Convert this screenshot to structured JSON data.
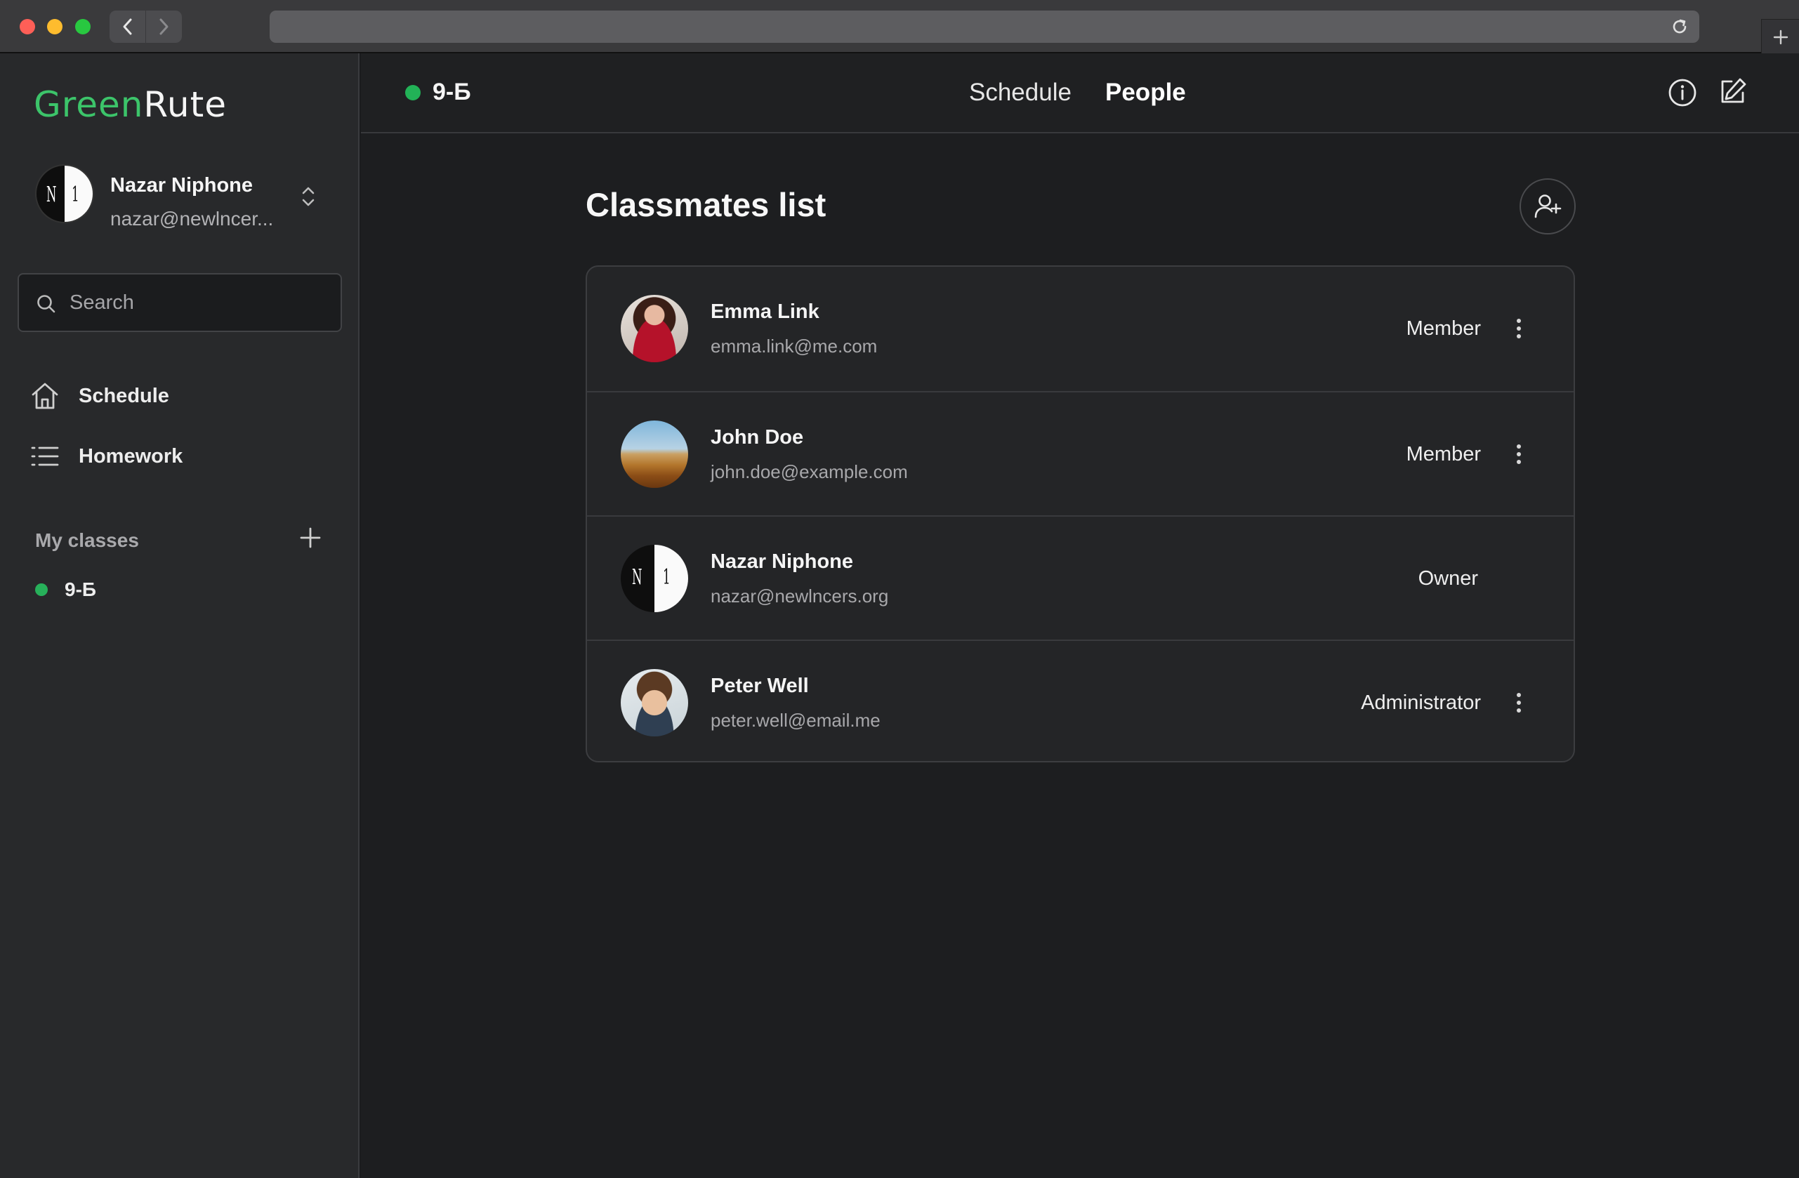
{
  "app": {
    "brand_left": "Green",
    "brand_right": "Rute",
    "accent_color": "#27b05a"
  },
  "account": {
    "name": "Nazar Niphone",
    "email": "nazar@newlncer...",
    "avatar_initials": [
      "N",
      "1"
    ]
  },
  "sidebar": {
    "search_placeholder": "Search",
    "nav": [
      {
        "label": "Schedule",
        "icon": "home-icon"
      },
      {
        "label": "Homework",
        "icon": "list-icon"
      }
    ],
    "my_classes_label": "My classes",
    "classes": [
      {
        "label": "9-Б",
        "status_color": "#27b05a"
      }
    ]
  },
  "topbar": {
    "class_name": "9-Б",
    "tabs": [
      {
        "label": "Schedule",
        "active": false
      },
      {
        "label": "People",
        "active": true
      }
    ]
  },
  "main": {
    "heading": "Classmates list",
    "members": [
      {
        "name": "Emma Link",
        "email": "emma.link@me.com",
        "role": "Member",
        "menu": true
      },
      {
        "name": "John Doe",
        "email": "john.doe@example.com",
        "role": "Member",
        "menu": true
      },
      {
        "name": "Nazar Niphone",
        "email": "nazar@newlncers.org",
        "role": "Owner",
        "menu": false
      },
      {
        "name": "Peter Well",
        "email": "peter.well@email.me",
        "role": "Administrator",
        "menu": true
      }
    ]
  }
}
